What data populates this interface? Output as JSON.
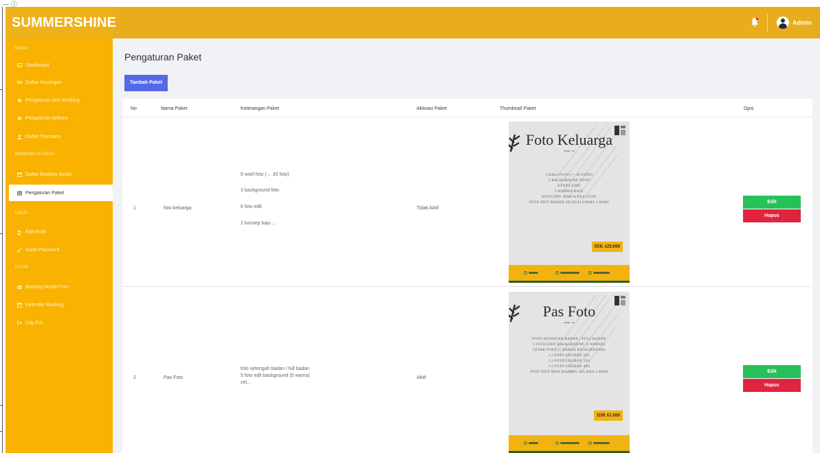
{
  "app": {
    "brand": "SUMMERSHINE",
    "user_name": "Admin",
    "window_corner": "— ⓘ"
  },
  "sidebar": {
    "heading_menu": "MENU",
    "menu_items": [
      {
        "label": "Dashboard",
        "icon": "monitor-icon"
      },
      {
        "label": "Daftar Keuangan",
        "icon": "scale-icon"
      },
      {
        "label": "Pengaturan Jam Booking",
        "icon": "gear-icon"
      },
      {
        "label": "Pengaturan Aplikasi",
        "icon": "gear-icon"
      },
      {
        "label": "Daftar Transaksi",
        "icon": "user-icon"
      }
    ],
    "heading_booking": "BOOKING STUDIO",
    "booking_items": [
      {
        "label": "Daftar Booking Studio",
        "icon": "calendar-icon"
      },
      {
        "label": "Pengaturan Paket",
        "icon": "package-icon",
        "active": true
      }
    ],
    "heading_user": "USER",
    "user_items": [
      {
        "label": "Edit Profil",
        "icon": "user-edit-icon"
      },
      {
        "label": "Ganti Password",
        "icon": "key-icon"
      }
    ],
    "heading_fitur": "FITUR",
    "fitur_items": [
      {
        "label": "Booking Studio Foto",
        "icon": "camera-icon"
      },
      {
        "label": "Kalender Booking",
        "icon": "calendar-icon"
      },
      {
        "label": "Log Out",
        "icon": "logout-icon"
      }
    ]
  },
  "page": {
    "title": "Pengaturan Paket",
    "add_button": "Tambah Paket"
  },
  "table": {
    "headers": [
      "No",
      "Nama Paket",
      "Keterangan Paket",
      "Aktivasi Paket",
      "Thumbnail Paket",
      "Opsi"
    ],
    "rows": [
      {
        "no": "1",
        "name": "foto keluarga",
        "desc_lines": [
          "6 wsel foto (→ 30 foto)",
          "3 background foto",
          "6 foto edit",
          "2 konsep baju ..."
        ],
        "status": "Tidak Aktif",
        "thumb": {
          "title": "Foto Keluarga",
          "sub": "PAKET - 01",
          "lines": [
            "1 KALI FOTO ( + 20 FOTO)",
            "3 BACKGROUND FOTO",
            "6 FOTO EDIT",
            "2 KONSEP BAJU",
            "SOFTCOPY SEMUA FILE FOTO",
            "FOTO EDIT BERSIH SELESAI LOOKS 2 HARI"
          ],
          "price": "IDR 428.000"
        },
        "edit": "Edit",
        "delete": "Hapus"
      },
      {
        "no": "2",
        "name": "Pas Foto",
        "desc_lines": [
          "foto setengah badan / full badan",
          "5 foto edit background (5 warna)",
          "cet..."
        ],
        "status": "Aktif",
        "thumb": {
          "title": "Pas Foto",
          "sub": "PAKET - 02",
          "lines": [
            "FOTO SETENGAH BADAN / FULL BADAN",
            "5 FOTO EDIT BACKGROUND (5 WARNA)",
            "CETAK FOTO (5 WARNA BACKGROUND)",
            "1.2 FOTO UKURAN 2X3",
            "1.2 FOTO UKURAN 3X4",
            "1.2 FOTO UKURAN 4X6",
            "FOTO EDIT BISA DIAMBIL SELAMA 2 HARI"
          ],
          "price": "IDR 65.000"
        },
        "edit": "Edit",
        "delete": "Hapus"
      }
    ]
  },
  "colors": {
    "topbar": "#e8ac1d",
    "sidebar": "#f9b200",
    "primary_button": "#5569e8",
    "edit_button": "#28c05a",
    "delete_button": "#e0243f"
  }
}
